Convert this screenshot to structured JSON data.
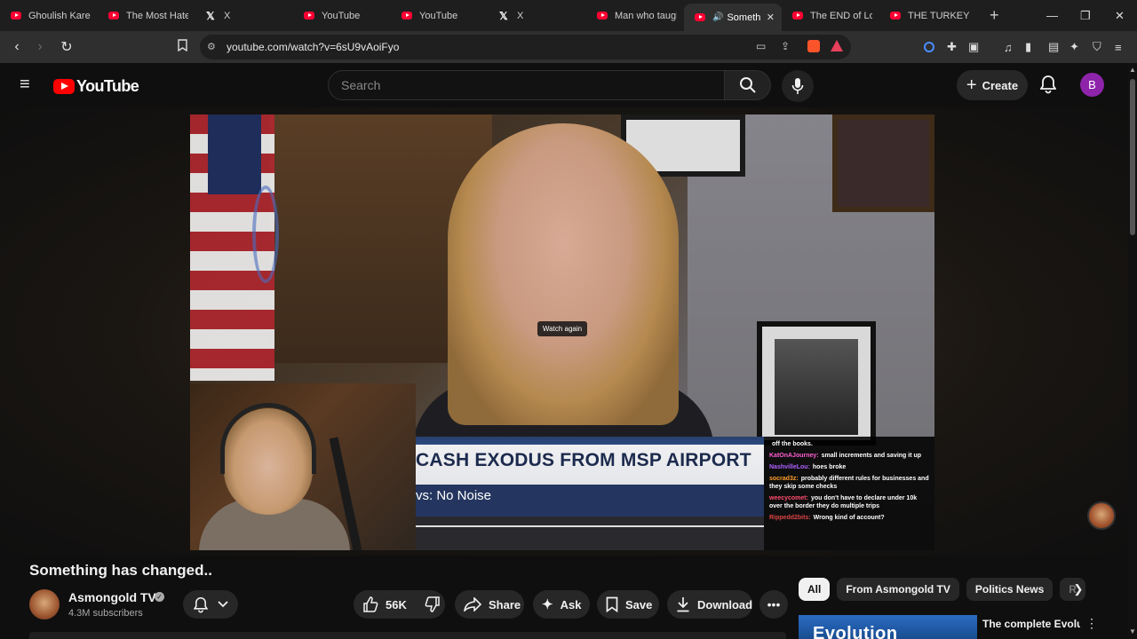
{
  "browser": {
    "tabs": [
      {
        "title": "Ghoulish Karen",
        "icon": "youtube-icon"
      },
      {
        "title": "The Most Hated",
        "icon": "youtube-icon"
      },
      {
        "title": "X",
        "icon": "x-icon"
      },
      {
        "title": "YouTube",
        "icon": "youtube-icon"
      },
      {
        "title": "YouTube",
        "icon": "youtube-icon"
      },
      {
        "title": "X",
        "icon": "x-icon"
      },
      {
        "title": "Man who taught",
        "icon": "youtube-icon"
      },
      {
        "title": "Something",
        "icon": "youtube-icon",
        "active": true
      },
      {
        "title": "The END of Lok",
        "icon": "youtube-icon"
      },
      {
        "title": "THE TURKEY TO",
        "icon": "youtube-icon"
      }
    ],
    "url": "youtube.com/watch?v=6sU9vAoiFyo"
  },
  "youtube": {
    "logo_text": "YouTube",
    "search_placeholder": "Search",
    "create_label": "Create",
    "avatar_letter": "B"
  },
  "player": {
    "watch_again": "Watch again",
    "banner_headline": "CASH EXODUS FROM MSP AIRPORT",
    "banner_sub": "vs: No Noise",
    "chat": [
      {
        "user": "",
        "text": "off the books."
      },
      {
        "user": "KatOnAJourney:",
        "text": "small increments and saving it up"
      },
      {
        "user": "NashvilleLou:",
        "text": "hoes broke"
      },
      {
        "user": "socrad3z:",
        "text": "probably different rules for businesses and they skip some checks"
      },
      {
        "user": "weecycomet:",
        "text": "you don't have to declare under 10k over the border they do multiple trips"
      },
      {
        "user": "Rippedd2bits:",
        "text": "Wrong kind of account?"
      }
    ]
  },
  "video": {
    "title": "Something has changed..",
    "channel": "Asmongold TV",
    "subscribers": "4.3M subscribers",
    "likes": "56K",
    "share": "Share",
    "ask": "Ask",
    "save": "Save",
    "download": "Download"
  },
  "sidebar": {
    "chips": [
      "All",
      "From Asmongold TV",
      "Politics News",
      "R"
    ],
    "rec_title": "The complete Evolution of Halo's",
    "rec_thumb_text": "Evolution"
  },
  "colors": {
    "yt_red": "#ff0000",
    "background": "#0f0f0f",
    "avatar": "#8e24aa"
  }
}
